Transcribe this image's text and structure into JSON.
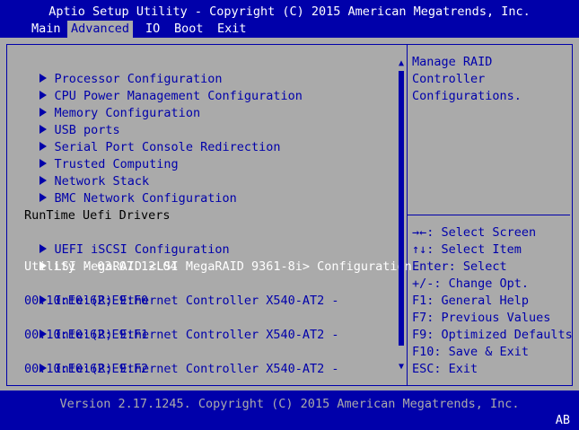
{
  "header": {
    "title": "Aptio Setup Utility - Copyright (C) 2015 American Megatrends, Inc."
  },
  "menu": [
    {
      "label": "Main",
      "active": false
    },
    {
      "label": "Advanced",
      "active": true
    },
    {
      "label": "IO",
      "active": false
    },
    {
      "label": "Boot",
      "active": false
    },
    {
      "label": "Exit",
      "active": false
    }
  ],
  "items": [
    {
      "label": "Processor Configuration",
      "type": "submenu"
    },
    {
      "label": "CPU Power Management Configuration",
      "type": "submenu"
    },
    {
      "label": "Memory Configuration",
      "type": "submenu"
    },
    {
      "label": "USB ports",
      "type": "submenu"
    },
    {
      "label": "Serial Port Console Redirection",
      "type": "submenu"
    },
    {
      "label": "Trusted Computing",
      "type": "submenu"
    },
    {
      "label": "Network Stack",
      "type": "submenu"
    },
    {
      "label": "BMC Network Configuration",
      "type": "submenu"
    },
    {
      "label": "",
      "type": "blank"
    },
    {
      "label": "RunTime Uefi Drivers",
      "type": "heading"
    },
    {
      "label": "UEFI iSCSI Configuration",
      "type": "submenu"
    },
    {
      "label": "LSI MegaRAID <LSI MegaRAID 9361-8i> Configuration",
      "type": "submenu",
      "selected": true
    },
    {
      "label": "Utility - 03.07.12.04",
      "type": "continuation",
      "selected": true
    },
    {
      "label": "Intel(R) Ethernet Controller X540-AT2 -",
      "type": "submenu"
    },
    {
      "label": "00:10:E0:62:E9:F0",
      "type": "continuation"
    },
    {
      "label": "Intel(R) Ethernet Controller X540-AT2 -",
      "type": "submenu"
    },
    {
      "label": "00:10:E0:62:E9:F1",
      "type": "continuation"
    },
    {
      "label": "Intel(R) Ethernet Controller X540-AT2 -",
      "type": "submenu"
    },
    {
      "label": "00:10:E0:62:E9:F2",
      "type": "continuation"
    }
  ],
  "scrollbar": {
    "up": "▲",
    "down": "▼",
    "position": 0.0,
    "visible_fraction": 0.95
  },
  "help": {
    "lines": [
      "Manage RAID",
      "Controller",
      "Configurations."
    ]
  },
  "keys": [
    "→←: Select Screen",
    "↑↓: Select Item",
    "Enter: Select",
    "+/-: Change Opt.",
    "F1: General Help",
    "F7: Previous Values",
    "F9: Optimized Defaults",
    "F10: Save & Exit",
    "ESC: Exit"
  ],
  "footer": {
    "version": "Version 2.17.1245. Copyright (C) 2015 American Megatrends, Inc."
  },
  "badge": "AB",
  "colors": {
    "background": "#0000aa",
    "panel": "#aaaaaa",
    "text": "#0000aa",
    "highlight": "#ffffff"
  }
}
